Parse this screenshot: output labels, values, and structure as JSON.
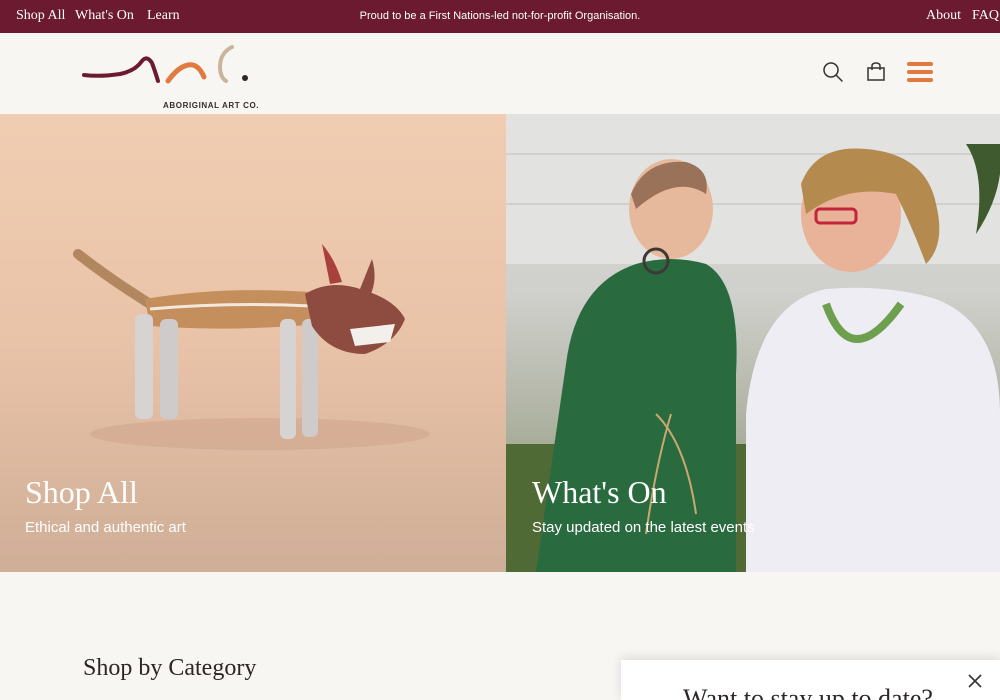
{
  "topbar": {
    "nav": [
      "Shop All",
      "What's On",
      "Learn"
    ],
    "announcement": "Proud to be a First Nations-led not-for-profit Organisation.",
    "right_links": [
      "About",
      "FAQ"
    ]
  },
  "brand": {
    "logo_text": "ABORIGINAL ART CO.",
    "colors": {
      "burgundy": "#6b1a2f",
      "orange": "#e07a3f",
      "sand": "#c9b59c"
    }
  },
  "header": {
    "icons": [
      "search-icon",
      "bag-icon",
      "menu-icon"
    ]
  },
  "hero": [
    {
      "title": "Shop All",
      "subtitle": "Ethical and authentic art"
    },
    {
      "title": "What's On",
      "subtitle": "Stay updated on the latest events"
    }
  ],
  "section": {
    "title": "Shop by Category"
  },
  "popup": {
    "title": "Want to stay up to date?"
  }
}
